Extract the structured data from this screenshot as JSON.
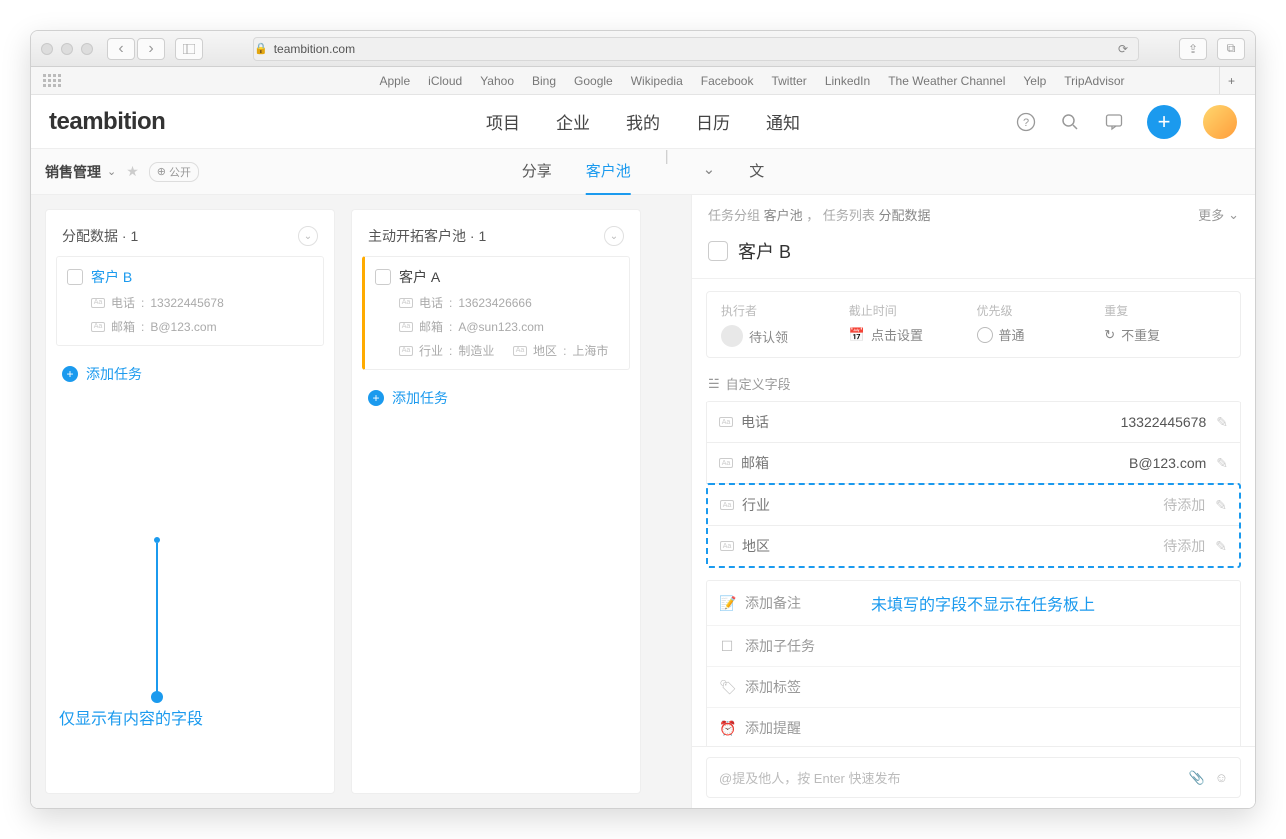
{
  "browser": {
    "url": "teambition.com",
    "favorites": [
      "Apple",
      "iCloud",
      "Yahoo",
      "Bing",
      "Google",
      "Wikipedia",
      "Facebook",
      "Twitter",
      "LinkedIn",
      "The Weather Channel",
      "Yelp",
      "TripAdvisor"
    ]
  },
  "logo": "teambition",
  "topnav": {
    "items": [
      "项目",
      "企业",
      "我的",
      "日历",
      "通知"
    ]
  },
  "subheader": {
    "breadcrumb": "销售管理",
    "visibility": "公开",
    "tabs": {
      "share": "分享",
      "pool": "客户池",
      "file": "文"
    }
  },
  "board": {
    "columns": [
      {
        "title": "分配数据 · 1",
        "cards": [
          {
            "title": "客户 B",
            "blue": true,
            "fields": [
              {
                "label": "电话",
                "value": "13322445678"
              },
              {
                "label": "邮箱",
                "value": "B@123.com"
              }
            ]
          }
        ],
        "add": "添加任务"
      },
      {
        "title": "主动开拓客户池 · 1",
        "cards": [
          {
            "title": "客户 A",
            "orange": true,
            "fields": [
              {
                "label": "电话",
                "value": "13623426666"
              },
              {
                "label": "邮箱",
                "value": "A@sun123.com"
              },
              {
                "label": "行业",
                "value": "制造业"
              },
              {
                "label": "地区",
                "value": "上海市"
              }
            ]
          }
        ],
        "add": "添加任务"
      }
    ]
  },
  "annotation1": "仅显示有内容的字段",
  "annotation2": "未填写的字段不显示在任务板上",
  "detail": {
    "crumb": {
      "group_label": "任务分组",
      "group": "客户池",
      "list_label": "任务列表",
      "list": "分配数据"
    },
    "more": "更多",
    "title": "客户 B",
    "meta": {
      "executor": {
        "label": "执行者",
        "value": "待认领"
      },
      "due": {
        "label": "截止时间",
        "value": "点击设置"
      },
      "priority": {
        "label": "优先级",
        "value": "普通"
      },
      "repeat": {
        "label": "重复",
        "value": "不重复"
      }
    },
    "custom_fields_header": "自定义字段",
    "fields": [
      {
        "name": "电话",
        "value": "13322445678",
        "placeholder": false
      },
      {
        "name": "邮箱",
        "value": "B@123.com",
        "placeholder": false
      },
      {
        "name": "行业",
        "value": "待添加",
        "placeholder": true
      },
      {
        "name": "地区",
        "value": "待添加",
        "placeholder": true
      }
    ],
    "adds": {
      "note": "添加备注",
      "subtask": "添加子任务",
      "tag": "添加标签",
      "reminder": "添加提醒"
    },
    "composer_placeholder": "@提及他人，按 Enter 快速发布"
  }
}
